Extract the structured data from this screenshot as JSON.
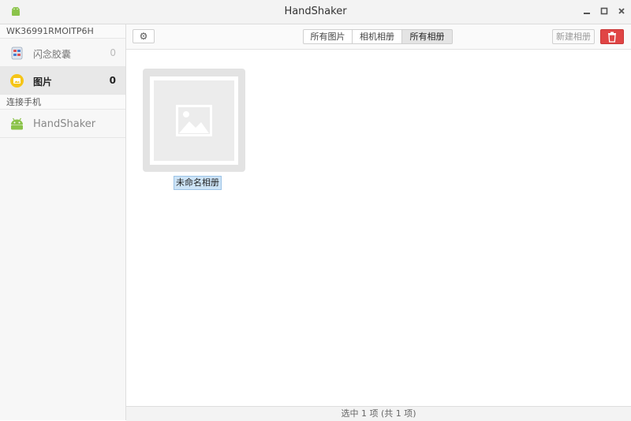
{
  "window": {
    "title": "HandShaker",
    "icon": "android-icon"
  },
  "sidebar": {
    "device_name": "WK36991RMOITP6H",
    "items": [
      {
        "label": "闪念胶囊",
        "count": "0",
        "icon": "capsule-icon"
      },
      {
        "label": "图片",
        "count": "0",
        "icon": "photo-icon"
      }
    ],
    "section_label": "连接手机",
    "phone": {
      "label": "HandShaker",
      "icon": "android-icon"
    }
  },
  "toolbar": {
    "tabs": [
      "所有图片",
      "相机相册",
      "所有相册"
    ],
    "active_tab": "所有相册",
    "new_album_label": "新建相册"
  },
  "albums": [
    {
      "name": "未命名相册"
    }
  ],
  "status": {
    "text": "选中 1 项 (共 1 项)"
  },
  "colors": {
    "delete": "#e04545",
    "android": "#8bc34a"
  }
}
